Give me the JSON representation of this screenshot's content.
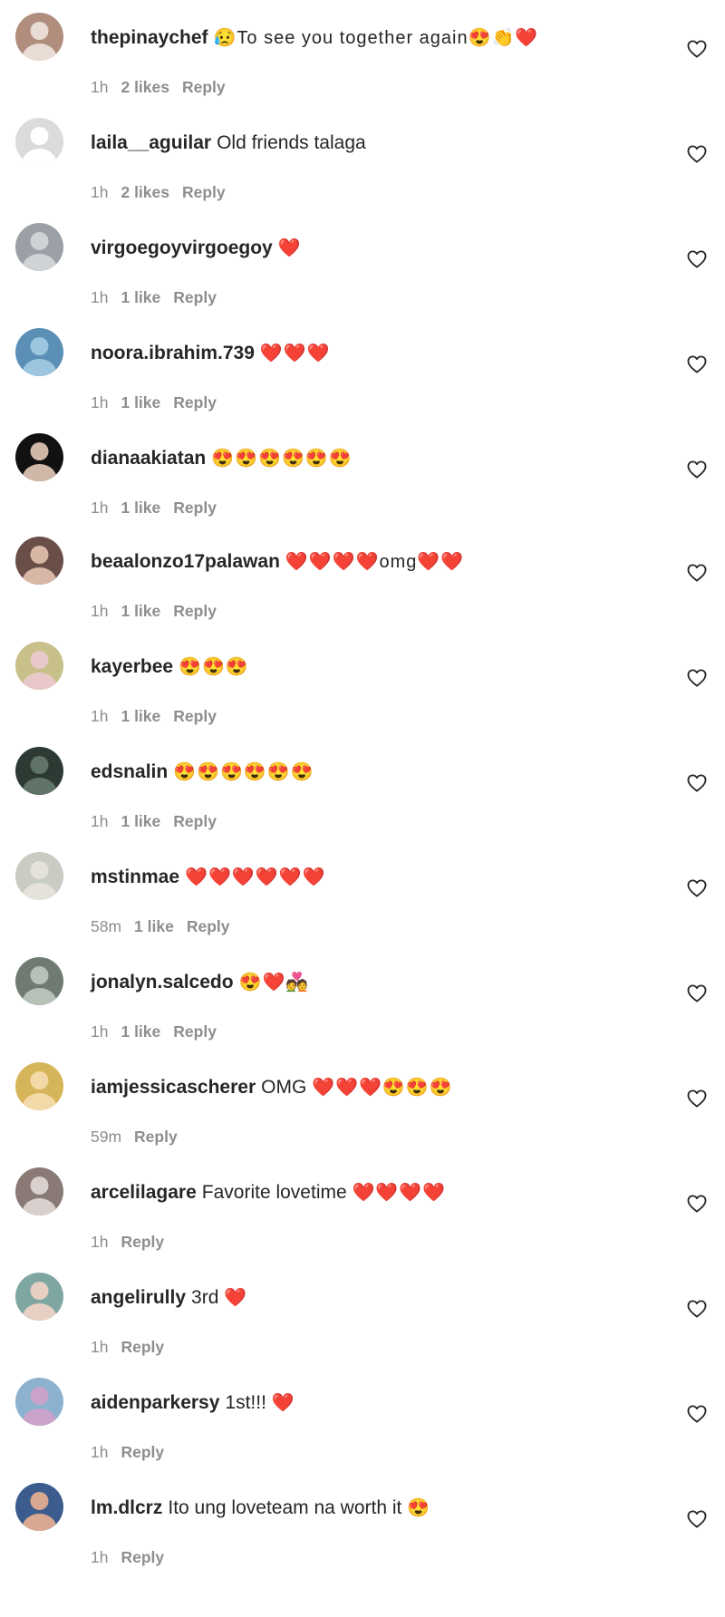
{
  "comments": [
    {
      "username": "thepinaychef",
      "text": "",
      "emoji_text": "😥To see you together again😍👏❤️",
      "time": "1h",
      "likes": "2 likes",
      "reply": "Reply",
      "avatar_color": "#b08d7d",
      "avatar_inner": "#e9dcd4",
      "like_icon": "heart-outline-icon"
    },
    {
      "username": "laila__aguilar",
      "text": "Old friends talaga",
      "emoji_text": "",
      "time": "1h",
      "likes": "2 likes",
      "reply": "Reply",
      "avatar_color": "#dbdbdb",
      "avatar_inner": "#ffffff",
      "like_icon": "heart-outline-icon"
    },
    {
      "username": "virgoegoyvirgoegoy",
      "text": "",
      "emoji_text": "❤️",
      "time": "1h",
      "likes": "1 like",
      "reply": "Reply",
      "avatar_color": "#9aa0a6",
      "avatar_inner": "#cfd3d6",
      "like_icon": "heart-outline-icon"
    },
    {
      "username": "noora.ibrahim.739",
      "text": "",
      "emoji_text": "❤️❤️❤️",
      "time": "1h",
      "likes": "1 like",
      "reply": "Reply",
      "avatar_color": "#5b8fb5",
      "avatar_inner": "#9cc6df",
      "like_icon": "heart-outline-icon"
    },
    {
      "username": "dianaakiatan",
      "text": "",
      "emoji_text": "😍😍😍😍😍😍",
      "time": "1h",
      "likes": "1 like",
      "reply": "Reply",
      "avatar_color": "#111111",
      "avatar_inner": "#cfb8a8",
      "like_icon": "heart-outline-icon"
    },
    {
      "username": "beaalonzo17palawan",
      "text": "",
      "emoji_text": "❤️❤️❤️❤️omg❤️❤️",
      "time": "1h",
      "likes": "1 like",
      "reply": "Reply",
      "avatar_color": "#6a4f49",
      "avatar_inner": "#d8b7a6",
      "like_icon": "heart-outline-icon"
    },
    {
      "username": "kayerbee",
      "text": "",
      "emoji_text": "😍😍😍",
      "time": "1h",
      "likes": "1 like",
      "reply": "Reply",
      "avatar_color": "#c7c08a",
      "avatar_inner": "#e8c8c8",
      "like_icon": "heart-outline-icon"
    },
    {
      "username": "edsnalin",
      "text": "",
      "emoji_text": "😍😍😍😍😍😍",
      "time": "1h",
      "likes": "1 like",
      "reply": "Reply",
      "avatar_color": "#2d3a33",
      "avatar_inner": "#5f7366",
      "like_icon": "heart-outline-icon"
    },
    {
      "username": "mstinmae",
      "text": "",
      "emoji_text": "❤️❤️❤️❤️❤️❤️",
      "time": "58m",
      "likes": "1 like",
      "reply": "Reply",
      "avatar_color": "#c8ccc2",
      "avatar_inner": "#e4e2da",
      "like_icon": "heart-outline-icon"
    },
    {
      "username": "jonalyn.salcedo",
      "text": "",
      "emoji_text": "😍❤️💑",
      "time": "1h",
      "likes": "1 like",
      "reply": "Reply",
      "avatar_color": "#6f7b70",
      "avatar_inner": "#b6c2b8",
      "like_icon": "heart-outline-icon"
    },
    {
      "username": "iamjessicascherer",
      "text": "OMG",
      "emoji_text": "❤️❤️❤️😍😍😍",
      "time": "59m",
      "likes": "",
      "reply": "Reply",
      "avatar_color": "#d6b45a",
      "avatar_inner": "#f3d9a8",
      "like_icon": "heart-outline-icon"
    },
    {
      "username": "arcelilagare",
      "text": "Favorite lovetime",
      "emoji_text": "❤️❤️❤️❤️",
      "time": "1h",
      "likes": "",
      "reply": "Reply",
      "avatar_color": "#8a7a76",
      "avatar_inner": "#d9cfcc",
      "like_icon": "heart-outline-icon"
    },
    {
      "username": "angelirully",
      "text": "3rd",
      "emoji_text": "❤️",
      "time": "1h",
      "likes": "",
      "reply": "Reply",
      "avatar_color": "#7fa7a2",
      "avatar_inner": "#e7cfc4",
      "like_icon": "heart-outline-icon"
    },
    {
      "username": "aidenparkersy",
      "text": "1st!!!",
      "emoji_text": "❤️",
      "time": "1h",
      "likes": "",
      "reply": "Reply",
      "avatar_color": "#8cb2cf",
      "avatar_inner": "#c9a3c9",
      "like_icon": "heart-outline-icon"
    },
    {
      "username": "lm.dlcrz",
      "text": "Ito ung loveteam na worth it",
      "emoji_text": "😍",
      "time": "1h",
      "likes": "",
      "reply": "Reply",
      "avatar_color": "#3b5c8c",
      "avatar_inner": "#d9a890",
      "like_icon": "heart-outline-icon"
    }
  ]
}
